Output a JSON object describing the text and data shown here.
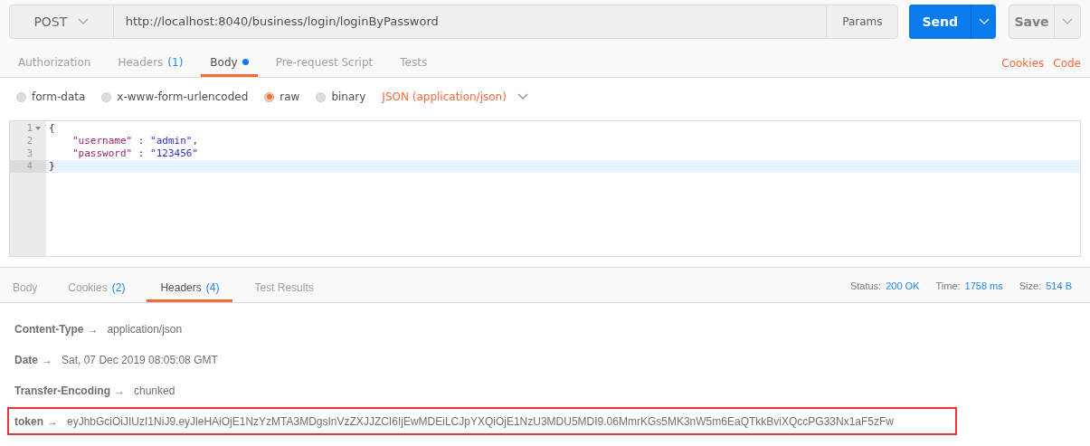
{
  "request": {
    "method": "POST",
    "url": "http://localhost:8040/business/login/loginByPassword",
    "params_label": "Params",
    "send_label": "Send",
    "save_label": "Save"
  },
  "request_tabs": [
    {
      "label": "Authorization",
      "selected": false
    },
    {
      "label": "Headers",
      "count": "(1)",
      "selected": false
    },
    {
      "label": "Body",
      "dot": true,
      "selected": true
    },
    {
      "label": "Pre-request Script",
      "selected": false
    },
    {
      "label": "Tests",
      "selected": false
    }
  ],
  "request_links": [
    "Cookies",
    "Code"
  ],
  "body_modes": [
    {
      "label": "form-data",
      "selected": false
    },
    {
      "label": "x-www-form-urlencoded",
      "selected": false
    },
    {
      "label": "raw",
      "selected": true
    },
    {
      "label": "binary",
      "selected": false
    }
  ],
  "content_type": "JSON (application/json)",
  "editor_lines": [
    {
      "number": "1",
      "fold": true,
      "active": false,
      "tokens": [
        {
          "kind": "punct",
          "text": "{"
        }
      ]
    },
    {
      "number": "2",
      "fold": false,
      "active": false,
      "indented": true,
      "tokens": [
        {
          "kind": "key",
          "text": "\"username\""
        },
        {
          "kind": "punct",
          "text": " : "
        },
        {
          "kind": "string",
          "text": "\"admin\""
        },
        {
          "kind": "punct",
          "text": ","
        }
      ]
    },
    {
      "number": "3",
      "fold": false,
      "active": false,
      "indented": true,
      "tokens": [
        {
          "kind": "key",
          "text": "\"password\""
        },
        {
          "kind": "punct",
          "text": " : "
        },
        {
          "kind": "string",
          "text": "\"123456\""
        }
      ]
    },
    {
      "number": "4",
      "fold": false,
      "active": true,
      "tokens": [
        {
          "kind": "punct",
          "text": "}"
        }
      ]
    }
  ],
  "response_tabs": [
    {
      "label": "Body",
      "selected": false
    },
    {
      "label": "Cookies",
      "count": "(2)",
      "selected": false
    },
    {
      "label": "Headers",
      "count": "(4)",
      "selected": true
    },
    {
      "label": "Test Results",
      "selected": false
    }
  ],
  "response_meta": [
    {
      "label": "Status:",
      "value": "200 OK"
    },
    {
      "label": "Time:",
      "value": "1758 ms"
    },
    {
      "label": "Size:",
      "value": "514 B"
    }
  ],
  "response_headers": [
    {
      "name": "Content-Type",
      "arrow": "→",
      "value": "application/json",
      "highlighted": false
    },
    {
      "name": "Date",
      "arrow": "→",
      "value": "Sat, 07 Dec 2019 08:05:08 GMT",
      "highlighted": false
    },
    {
      "name": "Transfer-Encoding",
      "arrow": "→",
      "value": "chunked",
      "highlighted": false
    },
    {
      "name": "token",
      "arrow": "→",
      "value": "eyJhbGciOiJIUzI1NiJ9.eyJleHAiOjE1NzYzMTA3MDgsInVzZXJJZCI6IjEwMDEiLCJpYXQiOjE1NzU3MDU5MDI9.06MmrKGs5MK3nW5m6EaQTkkBviXQccPG33Nx1aF5zFw",
      "highlighted": true
    }
  ]
}
